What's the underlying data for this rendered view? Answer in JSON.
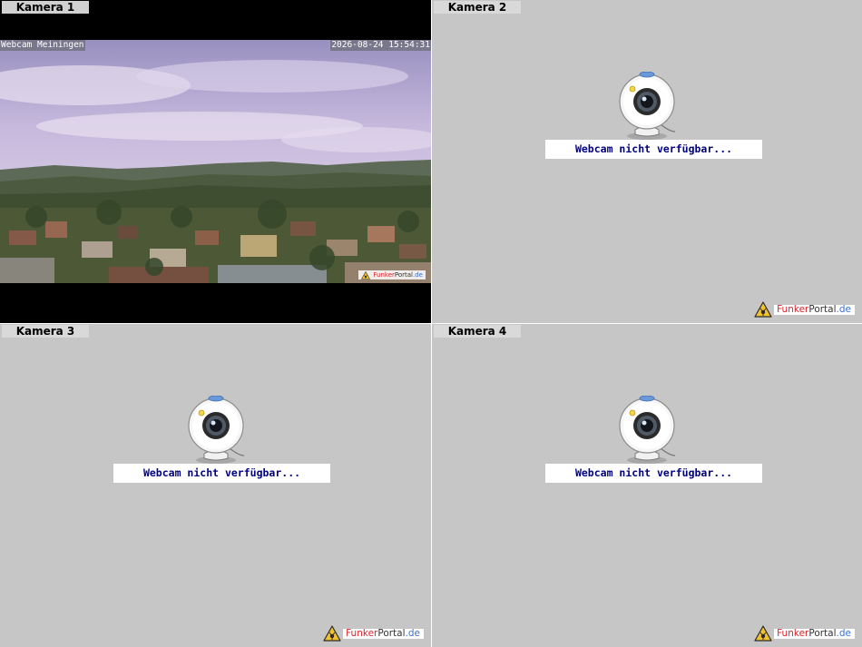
{
  "cameras": [
    {
      "label": "Kamera 1",
      "status": "live",
      "overlay_left": "Webcam Meiningen",
      "overlay_right": "2026-08-24 15:54:31"
    },
    {
      "label": "Kamera 2",
      "status": "unavailable",
      "message": "Webcam nicht verfügbar..."
    },
    {
      "label": "Kamera 3",
      "status": "unavailable",
      "message": "Webcam nicht verfügbar..."
    },
    {
      "label": "Kamera 4",
      "status": "unavailable",
      "message": "Webcam nicht verfügbar..."
    }
  ],
  "brand": {
    "part1": "Funk",
    "part2": "er",
    "part3": "Portal",
    "part4": ".de"
  },
  "colors": {
    "tile_background": "#c6c6c6",
    "message_text": "#000080",
    "brand_red": "#d8232a",
    "brand_blue": "#3a6fd1"
  },
  "icons": {
    "placeholder": "webcam-icon",
    "brand": "warning-triangle-icon"
  }
}
